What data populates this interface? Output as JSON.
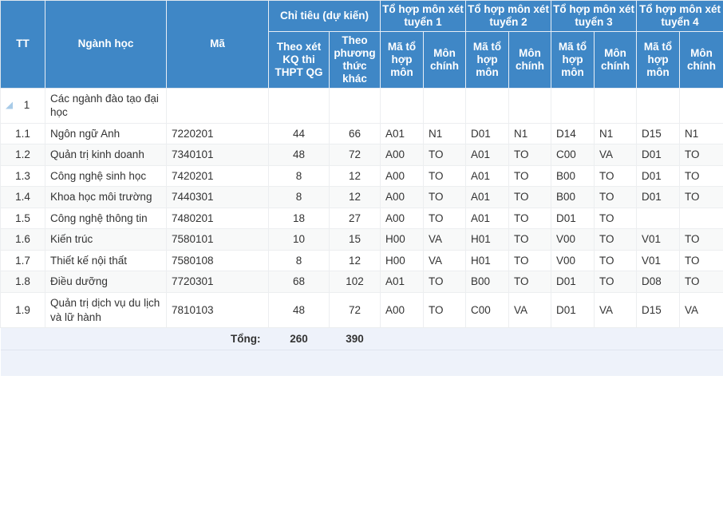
{
  "table": {
    "header": {
      "tt": "TT",
      "nganh_hoc": "Ngành học",
      "ma": "Mã",
      "chi_tieu_group": "Chỉ tiêu (dự kiến)",
      "chi_tieu_thpt": "Theo xét KQ thi THPT QG",
      "chi_tieu_khac": "Theo phương thức khác",
      "combo_groups": [
        "Tổ hợp môn xét tuyển 1",
        "Tổ hợp môn xét tuyển 2",
        "Tổ hợp môn xét tuyển 3",
        "Tổ hợp môn xét tuyển 4"
      ],
      "sub_ma_to_hop": "Mã tổ hợp môn",
      "sub_mon_chinh": "Môn chính"
    },
    "group_row": {
      "tt": "1",
      "label": "Các ngành đào tạo đại học",
      "collapse_icon": "collapse-triangle-icon"
    },
    "rows": [
      {
        "tt": "1.1",
        "nganh_hoc": "Ngôn ngữ Anh",
        "ma": "7220201",
        "thpt": "44",
        "khac": "66",
        "combos": [
          {
            "ma": "A01",
            "mon": "N1"
          },
          {
            "ma": "D01",
            "mon": "N1"
          },
          {
            "ma": "D14",
            "mon": "N1"
          },
          {
            "ma": "D15",
            "mon": "N1"
          }
        ]
      },
      {
        "tt": "1.2",
        "nganh_hoc": "Quản trị kinh doanh",
        "ma": "7340101",
        "thpt": "48",
        "khac": "72",
        "combos": [
          {
            "ma": "A00",
            "mon": "TO"
          },
          {
            "ma": "A01",
            "mon": "TO"
          },
          {
            "ma": "C00",
            "mon": "VA"
          },
          {
            "ma": "D01",
            "mon": "TO"
          }
        ]
      },
      {
        "tt": "1.3",
        "nganh_hoc": "Công nghệ sinh học",
        "ma": "7420201",
        "thpt": "8",
        "khac": "12",
        "combos": [
          {
            "ma": "A00",
            "mon": "TO"
          },
          {
            "ma": "A01",
            "mon": "TO"
          },
          {
            "ma": "B00",
            "mon": "TO"
          },
          {
            "ma": "D01",
            "mon": "TO"
          }
        ]
      },
      {
        "tt": "1.4",
        "nganh_hoc": "Khoa học môi trường",
        "ma": "7440301",
        "thpt": "8",
        "khac": "12",
        "combos": [
          {
            "ma": "A00",
            "mon": "TO"
          },
          {
            "ma": "A01",
            "mon": "TO"
          },
          {
            "ma": "B00",
            "mon": "TO"
          },
          {
            "ma": "D01",
            "mon": "TO"
          }
        ]
      },
      {
        "tt": "1.5",
        "nganh_hoc": "Công nghệ thông tin",
        "ma": "7480201",
        "thpt": "18",
        "khac": "27",
        "combos": [
          {
            "ma": "A00",
            "mon": "TO"
          },
          {
            "ma": "A01",
            "mon": "TO"
          },
          {
            "ma": "D01",
            "mon": "TO"
          },
          {
            "ma": "",
            "mon": ""
          }
        ]
      },
      {
        "tt": "1.6",
        "nganh_hoc": "Kiến trúc",
        "ma": "7580101",
        "thpt": "10",
        "khac": "15",
        "combos": [
          {
            "ma": "H00",
            "mon": "VA"
          },
          {
            "ma": "H01",
            "mon": "TO"
          },
          {
            "ma": "V00",
            "mon": "TO"
          },
          {
            "ma": "V01",
            "mon": "TO"
          }
        ]
      },
      {
        "tt": "1.7",
        "nganh_hoc": "Thiết kế nội thất",
        "ma": "7580108",
        "thpt": "8",
        "khac": "12",
        "combos": [
          {
            "ma": "H00",
            "mon": "VA"
          },
          {
            "ma": "H01",
            "mon": "TO"
          },
          {
            "ma": "V00",
            "mon": "TO"
          },
          {
            "ma": "V01",
            "mon": "TO"
          }
        ]
      },
      {
        "tt": "1.8",
        "nganh_hoc": "Điều dưỡng",
        "ma": "7720301",
        "thpt": "68",
        "khac": "102",
        "combos": [
          {
            "ma": "A01",
            "mon": "TO"
          },
          {
            "ma": "B00",
            "mon": "TO"
          },
          {
            "ma": "D01",
            "mon": "TO"
          },
          {
            "ma": "D08",
            "mon": "TO"
          }
        ]
      },
      {
        "tt": "1.9",
        "nganh_hoc": "Quản trị dịch vụ du lịch và lữ hành",
        "ma": "7810103",
        "thpt": "48",
        "khac": "72",
        "combos": [
          {
            "ma": "A00",
            "mon": "TO"
          },
          {
            "ma": "C00",
            "mon": "VA"
          },
          {
            "ma": "D01",
            "mon": "VA"
          },
          {
            "ma": "D15",
            "mon": "VA"
          }
        ]
      }
    ],
    "footer": {
      "label": "Tổng:",
      "total_thpt": "260",
      "total_khac": "390"
    }
  },
  "colors": {
    "header_blue": "#3f87c6",
    "stripe_gray": "#f8f9f9",
    "footer_blue": "#eef2fa",
    "icon_blue": "#a8cbe8",
    "border": "#eceef0"
  }
}
